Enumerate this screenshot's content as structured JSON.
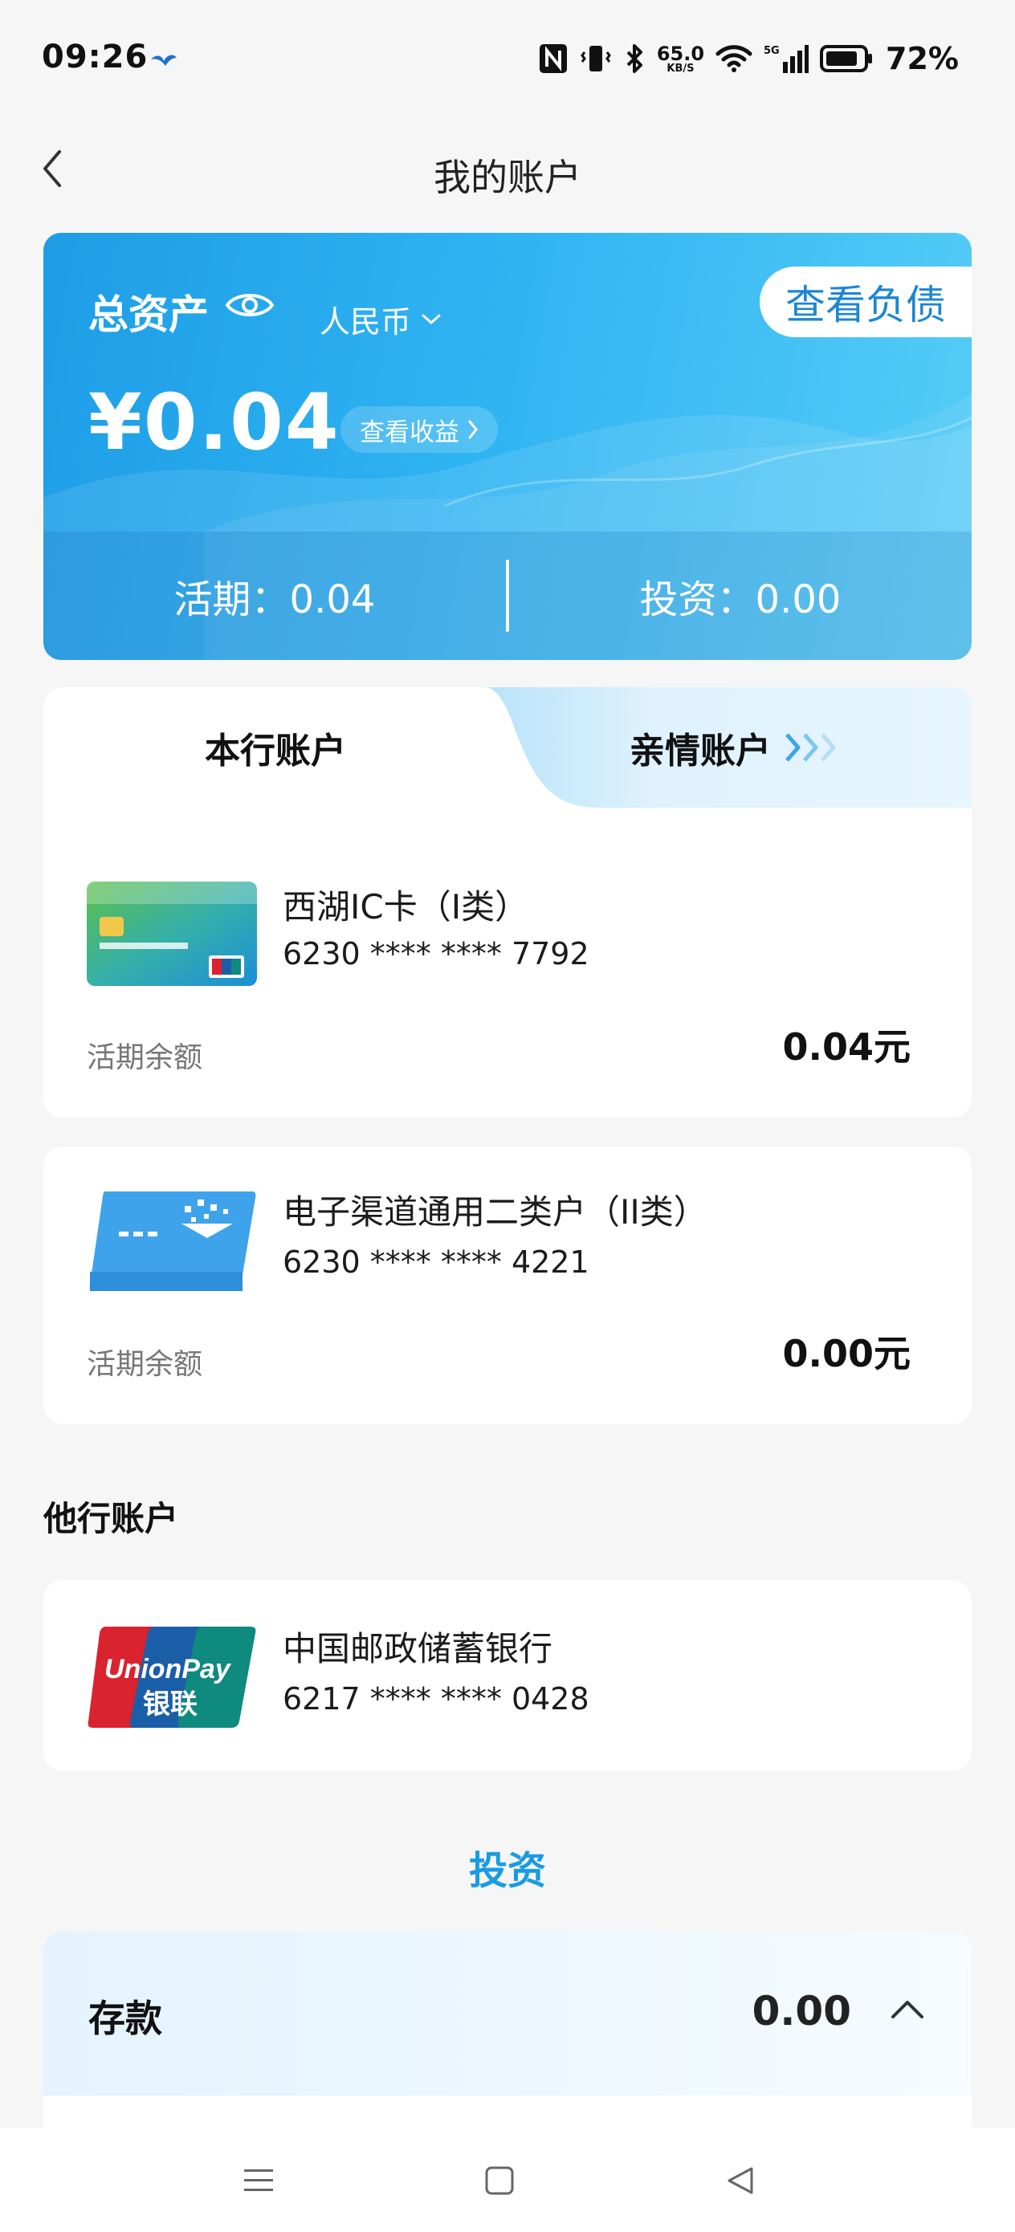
{
  "status_bar": {
    "time": "09:26",
    "net_speed": "65.0",
    "net_speed_unit": "KB/S",
    "network": "5G",
    "battery": "72%"
  },
  "header": {
    "title": "我的账户"
  },
  "asset_card": {
    "total_label": "总资产",
    "currency": "人民币",
    "liabilities_button": "查看负债",
    "total_amount": "¥0.04",
    "earnings_button": "查看收益",
    "demand": "活期：0.04",
    "investment": "投资：0.00"
  },
  "own_accounts": {
    "tab_own": "本行账户",
    "tab_family": "亲情账户",
    "accounts": [
      {
        "name": "西湖IC卡（I类）",
        "number": "6230 **** **** 7792",
        "balance_label": "活期余额",
        "balance": "0.04元"
      },
      {
        "name": "电子渠道通用二类户（II类）",
        "number": "6230 **** **** 4221",
        "balance_label": "活期余额",
        "balance": "0.00元"
      }
    ]
  },
  "other_accounts": {
    "title": "他行账户",
    "accounts": [
      {
        "name": "中国邮政储蓄银行",
        "number": "6217 **** **** 0428",
        "logo_text": "UnionPay",
        "logo_text_cn": "银联"
      }
    ]
  },
  "investment_section": {
    "title": "投资",
    "deposit_label": "存款",
    "deposit_value": "0.00"
  },
  "colors": {
    "accent_blue": "#1a9be0",
    "card_gradient_start": "#1e9de6",
    "card_gradient_end": "#56cdf7",
    "unionpay_red": "#d9232e",
    "unionpay_blue": "#1b5ea8",
    "unionpay_green": "#0e8a7e"
  },
  "icons": [
    "bird-icon",
    "nfc-icon",
    "vibrate-icon",
    "bluetooth-icon",
    "wifi-icon",
    "signal-icon",
    "battery-icon",
    "back-arrow-icon",
    "eye-icon",
    "chevron-down-icon",
    "chevron-right-icon",
    "triple-chevron-icon",
    "chevron-up-icon",
    "menu-icon",
    "home-icon",
    "back-triangle-icon"
  ]
}
